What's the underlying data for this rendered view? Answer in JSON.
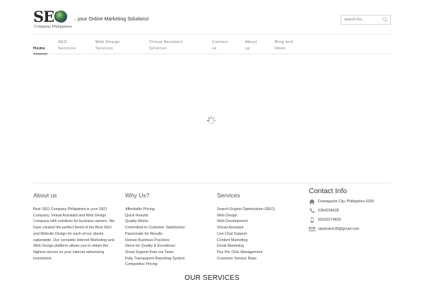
{
  "header": {
    "logo_text": "SEO",
    "logo_sub": "Company Philippines",
    "tagline": "...your Online Marketing Solutions!",
    "search_placeholder": "search for..."
  },
  "nav": {
    "items": [
      {
        "label": "Home"
      },
      {
        "label_line1": "SEO",
        "label_line2": "Services"
      },
      {
        "label_line1": "Web Design",
        "label_line2": "Services"
      },
      {
        "label_line1": "Virtual Assistant",
        "label_line2": "Services"
      },
      {
        "label_line1": "Contact",
        "label_line2": "us"
      },
      {
        "label_line1": "About",
        "label_line2": "us"
      },
      {
        "label_line1": "Blog and",
        "label_line2": "News"
      }
    ]
  },
  "footer": {
    "about": {
      "title": "About us",
      "text": "Best SEO Company Philippines is your SEO Company, Virtual Assistant and Web Design Company with solutions for business owners. We have created the perfect blend of the Best SEO and Website Design for each of our clients nationwide. Our complete Internet Marketing and Web Design platform allows you to obtain the highest returns on your internet advertising investment."
    },
    "why": {
      "title": "Why Us?",
      "items": [
        "Affordable Pricing",
        "Quick Results",
        "Quality Works",
        "Committed to Customer Satisfaction",
        "Passionate for Results",
        "Honest Business Practices",
        "Strive for Quality & Excellence",
        "Great Support from our Team",
        "Fully Transparent Reporting System",
        "Competitive Pricing"
      ]
    },
    "services": {
      "title": "Services",
      "items": [
        "Search Engine Optimization (SEO)",
        "Web Design",
        "Web Development",
        "Virtual Assistant",
        "Live Chat Support",
        "Content Marketing",
        "Email Marketing",
        "Pay Per Click Management",
        "Customer Service Reps"
      ]
    },
    "contact": {
      "title": "Contact Info",
      "address": "Dumaguete City, Philippines 6200",
      "phone": "0364209628",
      "mobile": "09183274839",
      "email": "stephatch28@gmail.com"
    }
  },
  "services_heading": "OUR SERVICES"
}
